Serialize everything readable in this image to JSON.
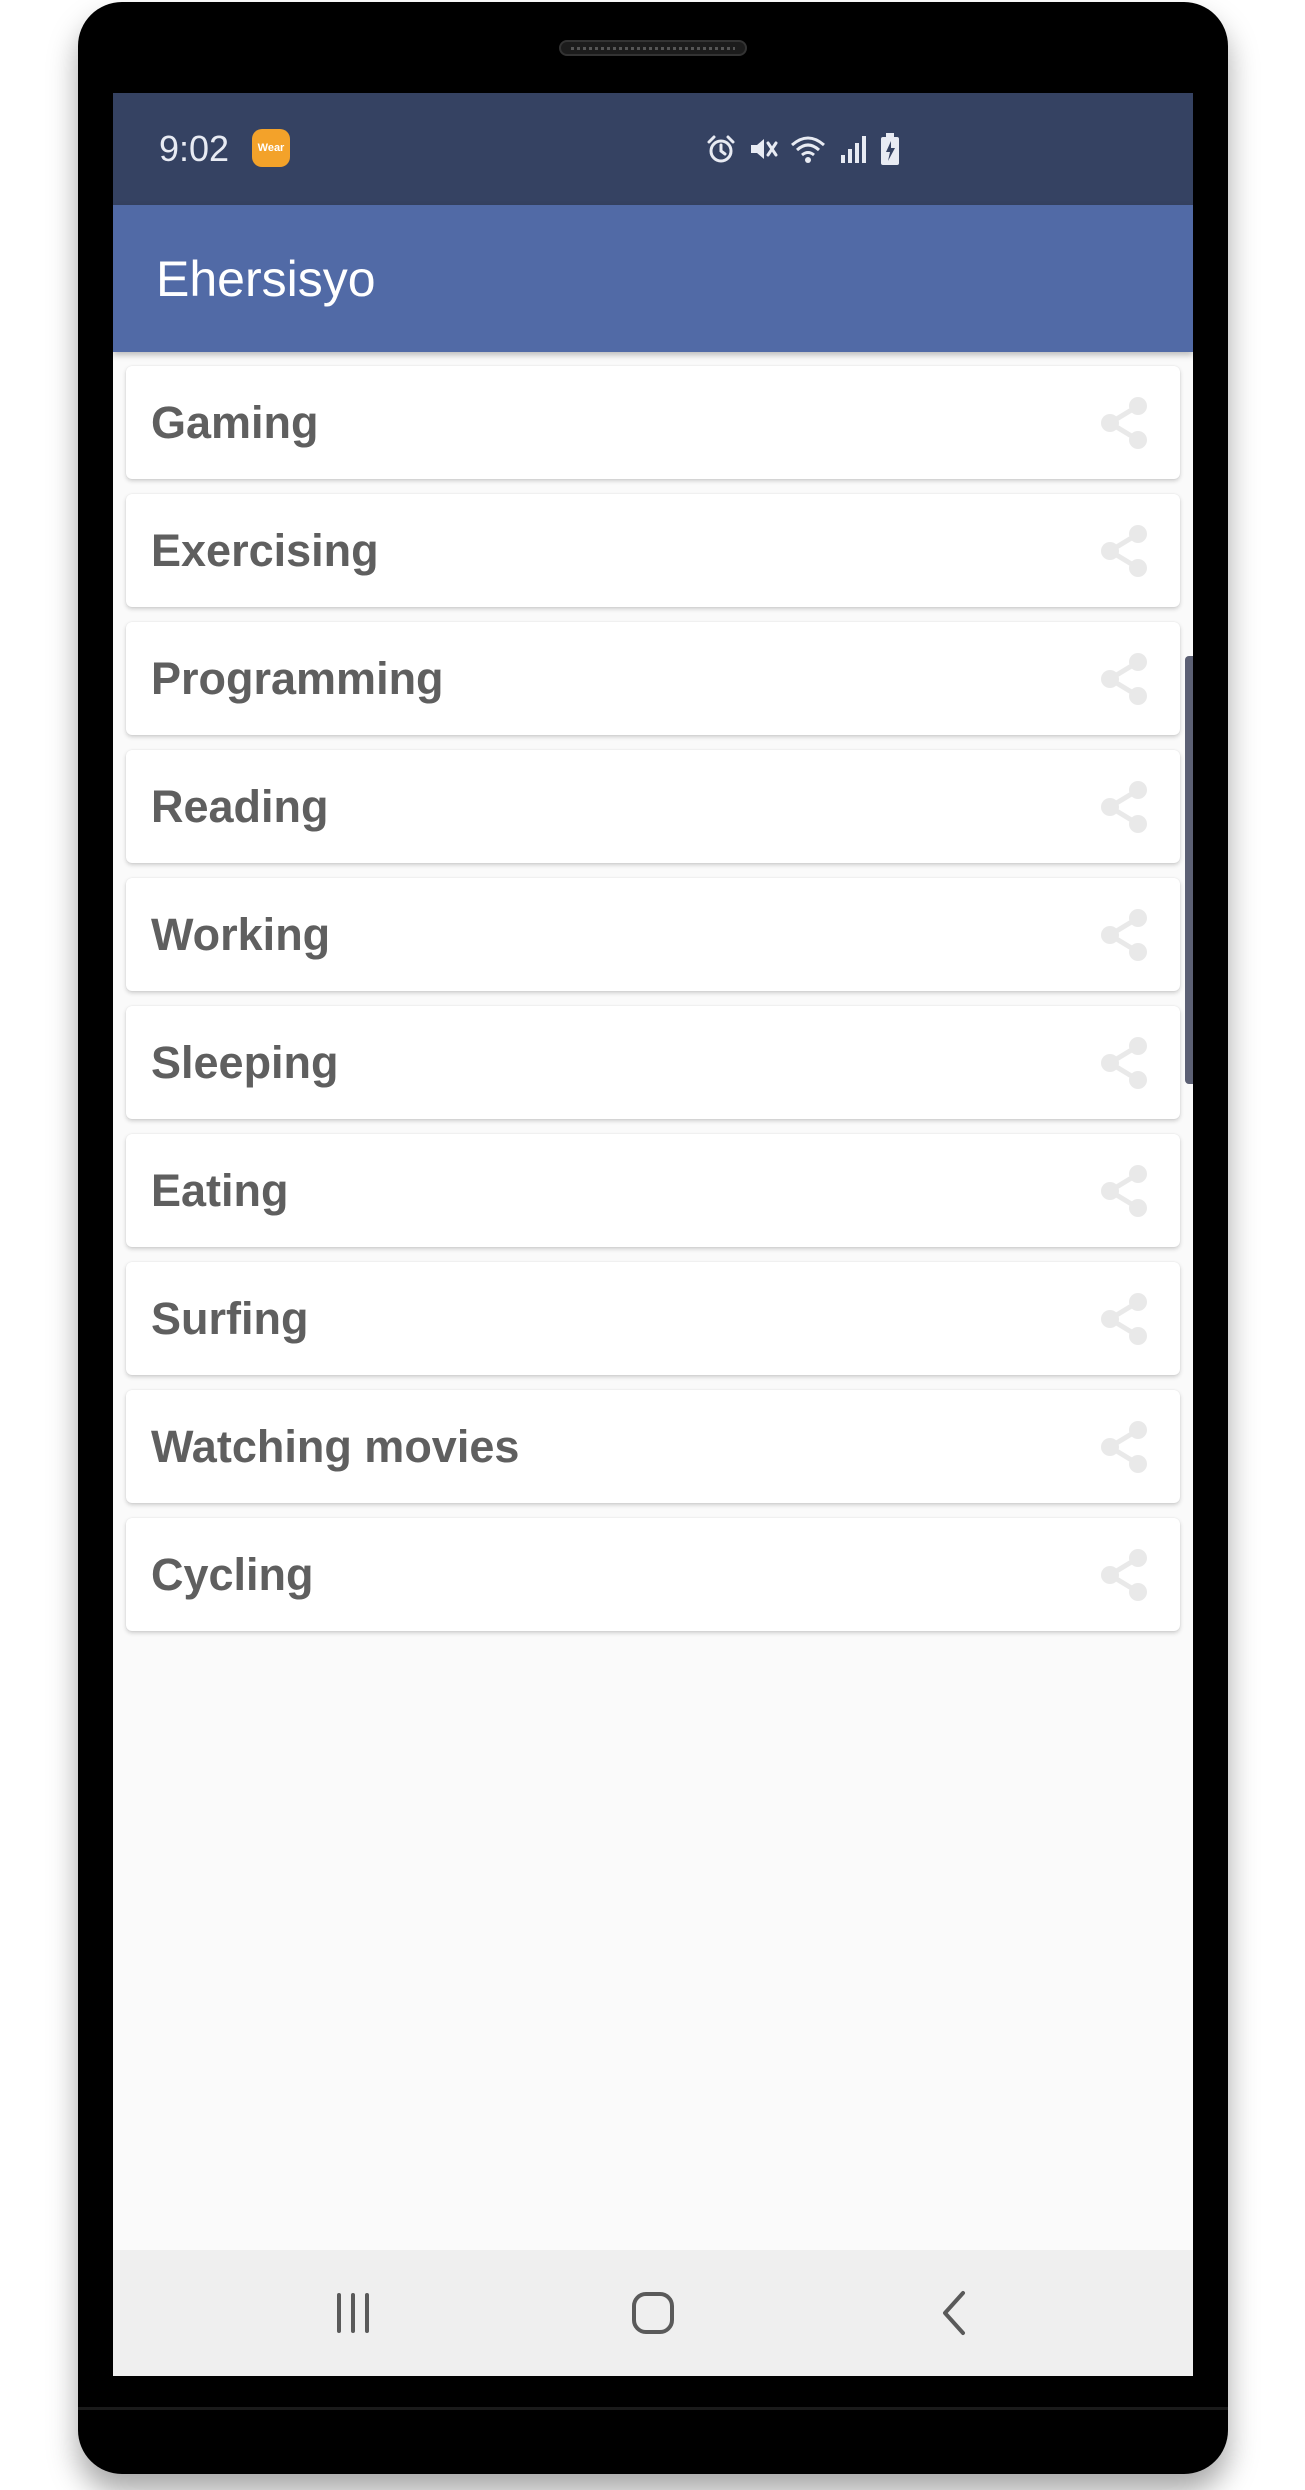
{
  "status_bar": {
    "time": "9:02",
    "wear_badge": "Wear"
  },
  "app_bar": {
    "title": "Ehersisyo"
  },
  "activities": [
    {
      "label": "Gaming"
    },
    {
      "label": "Exercising"
    },
    {
      "label": "Programming"
    },
    {
      "label": "Reading"
    },
    {
      "label": "Working"
    },
    {
      "label": "Sleeping"
    },
    {
      "label": "Eating"
    },
    {
      "label": "Surfing"
    },
    {
      "label": "Watching movies"
    },
    {
      "label": "Cycling"
    }
  ],
  "colors": {
    "status_bar": "#354262",
    "app_bar": "#516aa6",
    "item_text": "#5f5f5f",
    "share_icon": "#e9e9e9",
    "wear_badge": "#f3a22a"
  },
  "icons": {
    "item_action": "share-icon",
    "nav_recents": "recent-apps-icon",
    "nav_home": "home-icon",
    "nav_back": "back-icon"
  }
}
